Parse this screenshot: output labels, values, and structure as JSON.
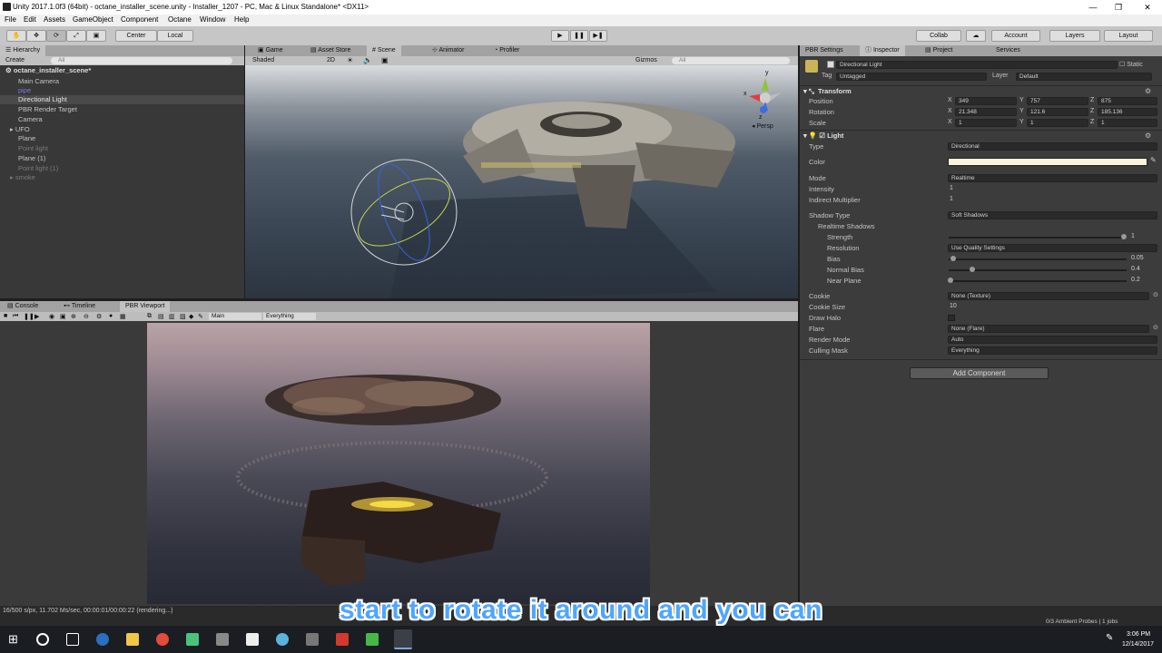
{
  "window": {
    "title": "Unity 2017.1.0f3 (64bit) - octane_installer_scene.unity - Installer_1207 - PC, Mac & Linux Standalone* <DX11>",
    "controls": [
      "—",
      "❐",
      "✕"
    ]
  },
  "menu": [
    "File",
    "Edit",
    "Assets",
    "GameObject",
    "Component",
    "Octane",
    "Window",
    "Help"
  ],
  "toolbar": {
    "pivot": "Center",
    "space": "Local",
    "collab": "Collab",
    "account": "Account",
    "layers": "Layers",
    "layout": "Layout"
  },
  "hierarchy": {
    "tab": "Hierarchy",
    "create": "Create",
    "search_placeholder": "All",
    "scene": "octane_installer_scene*",
    "items": [
      {
        "label": "Main Camera",
        "state": "normal"
      },
      {
        "label": "pipe",
        "state": "link"
      },
      {
        "label": "Directional Light",
        "state": "selected"
      },
      {
        "label": "PBR Render Target",
        "state": "normal"
      },
      {
        "label": "Camera",
        "state": "normal"
      },
      {
        "label": "UFO",
        "state": "normal"
      },
      {
        "label": "Plane",
        "state": "normal"
      },
      {
        "label": "Point light",
        "state": "dim"
      },
      {
        "label": "Plane (1)",
        "state": "normal"
      },
      {
        "label": "Point light (1)",
        "state": "dim"
      },
      {
        "label": "smoke",
        "state": "dim"
      }
    ]
  },
  "scene_tabs": [
    "Game",
    "Asset Store",
    "Scene",
    "Animator",
    "Profiler"
  ],
  "scene_toolbar": {
    "shading": "Shaded",
    "mode2d": "2D",
    "gizmos": "Gizmos",
    "search_placeholder": "All"
  },
  "scene_gizmo": {
    "x": "x",
    "y": "y",
    "z": "z",
    "persp": "Persp"
  },
  "bottom_tabs": [
    "Console",
    "Timeline",
    "PBR Viewport"
  ],
  "pbr_toolbar": {
    "camera": "Main",
    "layer": "Everything"
  },
  "render_status": "16/500 s/px, 11.702 Ms/sec, 00:00:01/00:00:22 (rendering...)",
  "inspector": {
    "tabs": [
      "PBR Settings",
      "Inspector",
      "Project",
      "Services"
    ],
    "object_name": "Directional Light",
    "static_label": "Static",
    "tag_label": "Tag",
    "tag_value": "Untagged",
    "layer_label": "Layer",
    "layer_value": "Default",
    "transform": {
      "title": "Transform",
      "position": {
        "label": "Position",
        "x": "349",
        "y": "757",
        "z": "875"
      },
      "rotation": {
        "label": "Rotation",
        "x": "21.348",
        "y": "121.6",
        "z": "185.136"
      },
      "scale": {
        "label": "Scale",
        "x": "1",
        "y": "1",
        "z": "1"
      }
    },
    "light": {
      "title": "Light",
      "type_label": "Type",
      "type_value": "Directional",
      "color_label": "Color",
      "color_value": "#fdf4dc",
      "mode_label": "Mode",
      "mode_value": "Realtime",
      "intensity_label": "Intensity",
      "intensity_value": "1",
      "indirect_label": "Indirect Multiplier",
      "indirect_value": "1",
      "shadow_type_label": "Shadow Type",
      "shadow_type_value": "Soft Shadows",
      "realtime_shadows_label": "Realtime Shadows",
      "strength_label": "Strength",
      "strength_value": "1",
      "resolution_label": "Resolution",
      "resolution_value": "Use Quality Settings",
      "bias_label": "Bias",
      "bias_value": "0.05",
      "normal_bias_label": "Normal Bias",
      "normal_bias_value": "0.4",
      "near_plane_label": "Near Plane",
      "near_plane_value": "0.2",
      "cookie_label": "Cookie",
      "cookie_value": "None (Texture)",
      "cookie_size_label": "Cookie Size",
      "cookie_size_value": "10",
      "draw_halo_label": "Draw Halo",
      "flare_label": "Flare",
      "flare_value": "None (Flare)",
      "render_mode_label": "Render Mode",
      "render_mode_value": "Auto",
      "culling_label": "Culling Mask",
      "culling_value": "Everything"
    },
    "add_component": "Add Component"
  },
  "status_right": "0/3 Ambient Probes | 1 jobs",
  "subtitle": "start to rotate it around and you can",
  "clock": {
    "time": "3:06 PM",
    "date": "12/14/2017"
  }
}
